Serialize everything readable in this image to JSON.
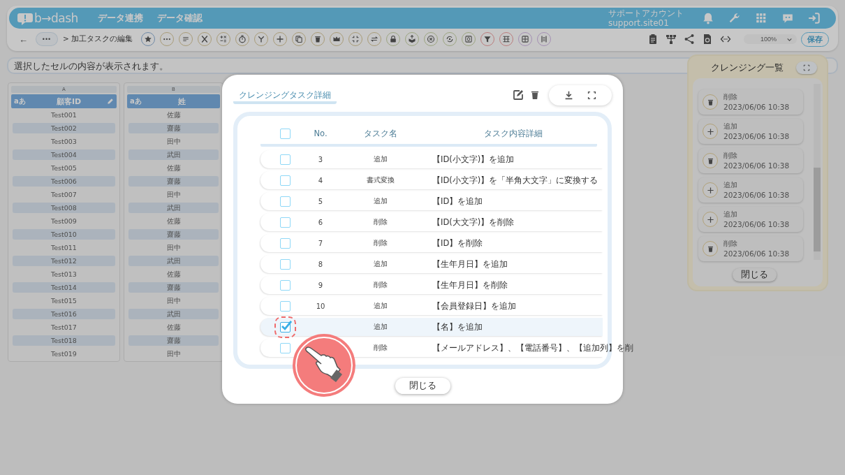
{
  "header": {
    "logo": "b→dash",
    "nav": [
      "データ連携",
      "データ確認"
    ],
    "account_name": "サポートアカウント",
    "account_id": "support.site01"
  },
  "toolbar": {
    "back": "←",
    "more": "•••",
    "breadcrumb": "> 加工タスクの編集",
    "zoom": "100%",
    "save": "保存"
  },
  "cell_bar": {
    "placeholder": "選択したセルの内容が表示されます。"
  },
  "sheet": {
    "columns": [
      {
        "letter": "A",
        "type_badge": "aあ",
        "name": "顧客ID",
        "edit_icon": true,
        "cells": [
          "Test001",
          "Test002",
          "Test003",
          "Test004",
          "Test005",
          "Test006",
          "Test007",
          "Test008",
          "Test009",
          "Test010",
          "Test011",
          "Test012",
          "Test013",
          "Test014",
          "Test015",
          "Test016",
          "Test017",
          "Test018",
          "Test019"
        ]
      },
      {
        "letter": "B",
        "type_badge": "aあ",
        "name": "姓",
        "cells": [
          "佐藤",
          "齋藤",
          "田中",
          "武田",
          "佐藤",
          "齋藤",
          "田中",
          "武田",
          "佐藤",
          "齋藤",
          "田中",
          "武田",
          "佐藤",
          "齋藤",
          "田中",
          "武田",
          "佐藤",
          "齋藤",
          "田中"
        ]
      }
    ]
  },
  "cleansing_panel": {
    "title": "クレンジング一覧",
    "items": [
      {
        "kind": "delete",
        "label": "削除",
        "time": "2023/06/06 10:38"
      },
      {
        "kind": "add",
        "label": "追加",
        "time": "2023/06/06 10:38"
      },
      {
        "kind": "delete",
        "label": "削除",
        "time": "2023/06/06 10:38"
      },
      {
        "kind": "add",
        "label": "追加",
        "time": "2023/06/06 10:38"
      },
      {
        "kind": "add",
        "label": "追加",
        "time": "2023/06/06 10:38"
      },
      {
        "kind": "delete",
        "label": "削除",
        "time": "2023/06/06 10:38"
      }
    ],
    "close": "閉じる"
  },
  "modal": {
    "title": "クレンジングタスク詳細",
    "columns": [
      "No.",
      "タスク名",
      "タスク内容詳細"
    ],
    "header_checked": false,
    "rows": [
      {
        "no": "3",
        "name": "追加",
        "detail": "【ID(小文字)】を追加",
        "checked": false
      },
      {
        "no": "4",
        "name": "書式変換",
        "detail": "【ID(小文字)】を「半角大文字」に変換する",
        "checked": false
      },
      {
        "no": "5",
        "name": "追加",
        "detail": "【ID】を追加",
        "checked": false
      },
      {
        "no": "6",
        "name": "削除",
        "detail": "【ID(大文字)】を削除",
        "checked": false
      },
      {
        "no": "7",
        "name": "削除",
        "detail": "【ID】を削除",
        "checked": false
      },
      {
        "no": "8",
        "name": "追加",
        "detail": "【生年月日】を追加",
        "checked": false
      },
      {
        "no": "9",
        "name": "削除",
        "detail": "【生年月日】を削除",
        "checked": false
      },
      {
        "no": "10",
        "name": "追加",
        "detail": "【会員登録日】を追加",
        "checked": false
      },
      {
        "name": "追加",
        "detail": "【名】を追加",
        "checked": true
      },
      {
        "name": "削除",
        "detail": "【メールアドレス】、【電話番号】、【追加列】を削",
        "checked": false
      }
    ],
    "close": "閉じる"
  }
}
